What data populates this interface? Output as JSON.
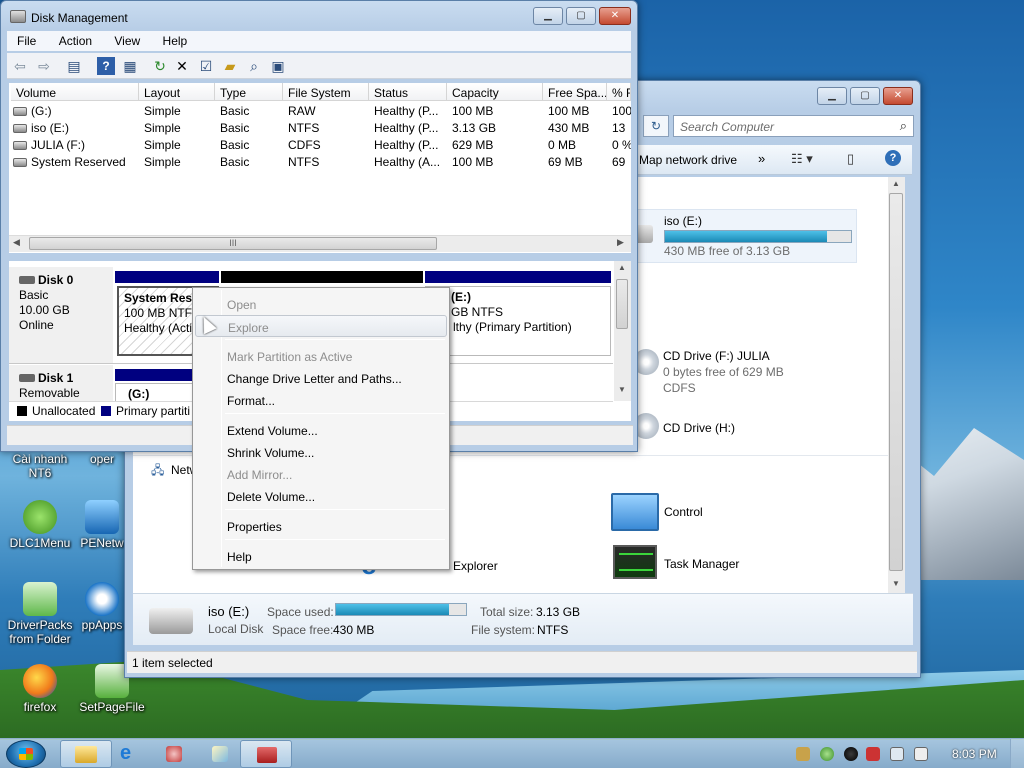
{
  "desktop": {
    "icons": [
      {
        "label": "Cài nhanh\nNT6",
        "name": "cai-nhanh-nt6"
      },
      {
        "label": "oper",
        "name": "oper"
      },
      {
        "label": "DLC1Menu",
        "name": "dlc1menu"
      },
      {
        "label": "PENetw",
        "name": "penetw"
      },
      {
        "label": "DriverPacks\nfrom Folder",
        "name": "driverpacks"
      },
      {
        "label": "ppApps",
        "name": "ppapps"
      },
      {
        "label": "firefox",
        "name": "firefox"
      },
      {
        "label": "SetPageFile",
        "name": "setpagefile"
      }
    ]
  },
  "disk_mgmt": {
    "title": "Disk Management",
    "menu": [
      "File",
      "Action",
      "View",
      "Help"
    ],
    "columns": [
      "Volume",
      "Layout",
      "Type",
      "File System",
      "Status",
      "Capacity",
      "Free Spa...",
      "% F"
    ],
    "rows": [
      [
        "(G:)",
        "Simple",
        "Basic",
        "RAW",
        "Healthy (P...",
        "100 MB",
        "100 MB",
        "100"
      ],
      [
        "iso (E:)",
        "Simple",
        "Basic",
        "NTFS",
        "Healthy (P...",
        "3.13 GB",
        "430 MB",
        "13"
      ],
      [
        "JULIA (F:)",
        "Simple",
        "Basic",
        "CDFS",
        "Healthy (P...",
        "629 MB",
        "0 MB",
        "0 %"
      ],
      [
        "System Reserved",
        "Simple",
        "Basic",
        "NTFS",
        "Healthy (A...",
        "100 MB",
        "69 MB",
        "69"
      ]
    ],
    "hscroll_grip": "III",
    "disk0": {
      "name": "Disk 0",
      "type": "Basic",
      "size": "10.00 GB",
      "state": "Online",
      "p1": {
        "name": "System Rese",
        "size": "100 MB NTFS",
        "status": "Healthy (Acti"
      },
      "p3": {
        "name": "(E:)",
        "size": "GB NTFS",
        "status": "lthy (Primary Partition)"
      }
    },
    "disk1": {
      "name": "Disk 1",
      "type": "Removable",
      "p1": {
        "name": "(G:)"
      }
    },
    "legend": {
      "unallocated": "Unallocated",
      "primary": "Primary partiti"
    }
  },
  "context_menu": {
    "items": [
      {
        "label": "Open",
        "state": "disabled"
      },
      {
        "label": "Explore",
        "state": "hover"
      },
      {
        "label": "Mark Partition as Active",
        "state": "disabled"
      },
      {
        "label": "Change Drive Letter and Paths...",
        "state": "enabled"
      },
      {
        "label": "Format...",
        "state": "enabled"
      },
      {
        "label": "Extend Volume...",
        "state": "enabled"
      },
      {
        "label": "Shrink Volume...",
        "state": "enabled"
      },
      {
        "label": "Add Mirror...",
        "state": "disabled"
      },
      {
        "label": "Delete Volume...",
        "state": "enabled"
      },
      {
        "label": "Properties",
        "state": "enabled"
      },
      {
        "label": "Help",
        "state": "enabled"
      }
    ]
  },
  "explorer": {
    "search_placeholder": "Search Computer",
    "map_drive": "Map network drive",
    "more": "»",
    "iso": {
      "name": "iso (E:)",
      "free": "430 MB free of 3.13 GB",
      "used_fraction": 0.87
    },
    "cd_f": {
      "name": "CD Drive (F:) JULIA",
      "free": "0 bytes free of 629 MB",
      "fs": "CDFS"
    },
    "cd_h": {
      "name": "CD Drive (H:)"
    },
    "network": "Netw",
    "control": "Control",
    "ie": "Internet Explorer",
    "task_manager": "Task Manager",
    "details": {
      "name": "iso (E:)",
      "type": "Local Disk",
      "space_used_label": "Space used:",
      "space_free_label": "Space free:",
      "space_free": "430 MB",
      "total_size_label": "Total size:",
      "total_size": "3.13 GB",
      "fs_label": "File system:",
      "fs": "NTFS",
      "used_fraction": 0.87
    },
    "status": "1 item selected"
  },
  "taskbar": {
    "time": "8:03 PM"
  },
  "colors": {
    "primary_partition": "#00008b",
    "unallocated": "#000000",
    "accent": "#1b8ab6"
  }
}
